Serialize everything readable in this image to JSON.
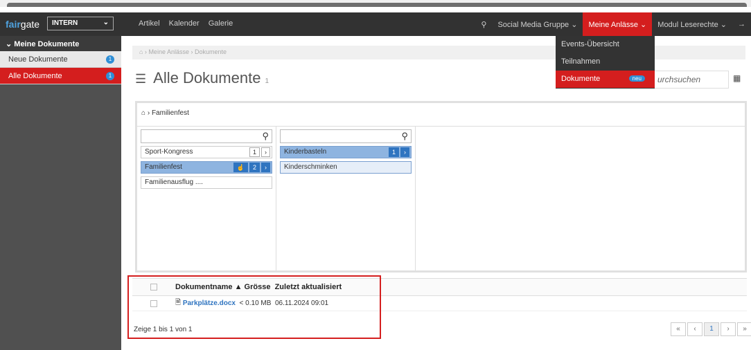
{
  "nav": {
    "brand1": "fair",
    "brand2": "gate",
    "org": "INTERN",
    "menu": [
      "Artikel",
      "Kalender",
      "Galerie"
    ],
    "right": [
      "Social Media Gruppe ⌄",
      "Meine Anlässe ⌄",
      "Modul Leserechte ⌄"
    ]
  },
  "sidebar": {
    "title": "Meine Dokumente",
    "items": [
      {
        "label": "Neue Dokumente",
        "count": "1"
      },
      {
        "label": "Alle Dokumente",
        "count": "1"
      }
    ]
  },
  "breadcrumb": "Meine Anlässe › Dokumente",
  "page": {
    "title": "Alle Dokumente",
    "count": "1",
    "search": "urchsuchen"
  },
  "explorer": {
    "path": "Familienfest",
    "col1": [
      {
        "label": "Sport-Kongress",
        "count": "1"
      },
      {
        "label": "Familienfest",
        "count": "2"
      },
      {
        "label": "Familienausflug ...."
      }
    ],
    "col2": [
      {
        "label": "Kinderbasteln",
        "count": "1"
      },
      {
        "label": "Kinderschminken"
      }
    ]
  },
  "table": {
    "headers": [
      "Dokumentname",
      "Grösse",
      "Zuletzt aktualisiert"
    ],
    "rows": [
      {
        "name": "Parkplätze.docx",
        "size": "< 0.10 MB",
        "date": "06.11.2024 09:01"
      }
    ],
    "info": "Zeige 1 bis 1 von 1"
  },
  "pager": [
    "«",
    "‹",
    "1",
    "›",
    "»"
  ],
  "dropdown": [
    "Events-Übersicht",
    "Teilnahmen",
    "Dokumente",
    "neu"
  ]
}
